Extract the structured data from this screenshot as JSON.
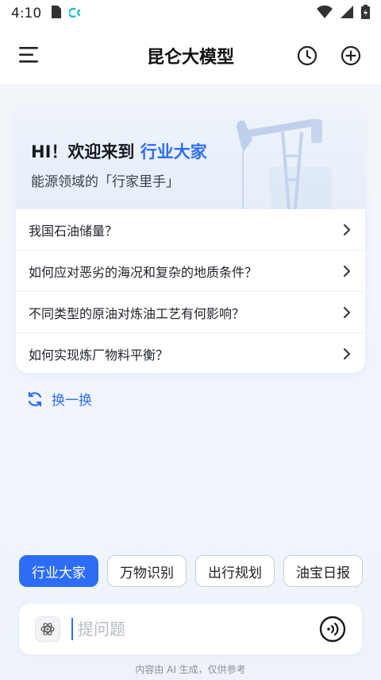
{
  "status_bar": {
    "time": "4:10",
    "icons": [
      "sim-card-icon",
      "app-notification-icon",
      "wifi-icon",
      "signal-icon",
      "battery-icon"
    ]
  },
  "header": {
    "title": "昆仑大模型",
    "icons": [
      "menu-icon",
      "history-clock-icon",
      "add-circle-icon"
    ]
  },
  "welcome": {
    "greeting_prefix": "HI！欢迎来到",
    "greeting_highlight": "行业大家",
    "subtitle": "能源领域的「行家里手」",
    "questions": [
      "我国石油储量？",
      "如何应对恶劣的海况和复杂的地质条件？",
      "不同类型的原油对炼油工艺有何影响？",
      "如何实现炼厂物料平衡？"
    ]
  },
  "refresh": {
    "label": "换一换",
    "icon": "refresh-icon"
  },
  "chips": [
    {
      "label": "行业大家",
      "active": true
    },
    {
      "label": "万物识别",
      "active": false
    },
    {
      "label": "出行规划",
      "active": false
    },
    {
      "label": "油宝日报",
      "active": false
    }
  ],
  "input": {
    "placeholder": "提问题",
    "value": "",
    "icons": [
      "atom-attach-icon",
      "voice-wave-icon"
    ]
  },
  "disclaimer": "内容由 AI 生成，仅供参考",
  "colors": {
    "accent": "#2d6df6",
    "background": "#f2f5fb",
    "card": "#ffffff"
  }
}
